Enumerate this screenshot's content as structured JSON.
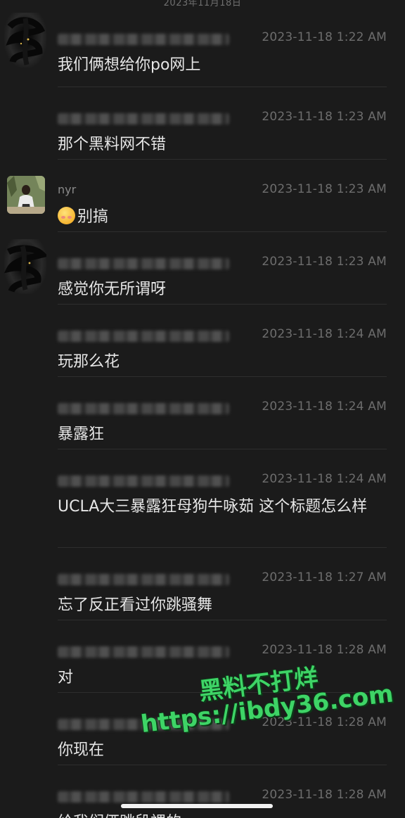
{
  "header": {
    "date": "2023年11月18日"
  },
  "messages": [
    {
      "sender": "",
      "time": "2023-11-18 1:22 AM",
      "text": "我们俩想给你po网上"
    },
    {
      "sender": "",
      "time": "2023-11-18 1:23 AM",
      "text": "那个黑料网不错"
    },
    {
      "sender": "nyr",
      "time": "2023-11-18 1:23 AM",
      "text": "别搞",
      "emoji": "blushing-smile-emoji"
    },
    {
      "sender": "",
      "time": "2023-11-18 1:23 AM",
      "text": "感觉你无所谓呀"
    },
    {
      "sender": "",
      "time": "2023-11-18 1:24 AM",
      "text": "玩那么花"
    },
    {
      "sender": "",
      "time": "2023-11-18 1:24 AM",
      "text": "暴露狂"
    },
    {
      "sender": "",
      "time": "2023-11-18 1:24 AM",
      "text": "UCLA大三暴露狂母狗牛咏茹 这个标题怎么样"
    },
    {
      "sender": "",
      "time": "2023-11-18 1:27 AM",
      "text": "忘了反正看过你跳骚舞"
    },
    {
      "sender": "",
      "time": "2023-11-18 1:28 AM",
      "text": "对"
    },
    {
      "sender": "",
      "time": "2023-11-18 1:28 AM",
      "text": "你现在"
    },
    {
      "sender": "",
      "time": "2023-11-18 1:28 AM",
      "text": "给我们俩跳段裸的"
    }
  ],
  "watermark": {
    "line1": "黑料不打烊",
    "line2": "https://ibdy36.com"
  },
  "colors": {
    "background": "#1b1b1b",
    "text": "#e6e6e6",
    "time": "#6d6d6d",
    "watermark": "#3ed466"
  }
}
